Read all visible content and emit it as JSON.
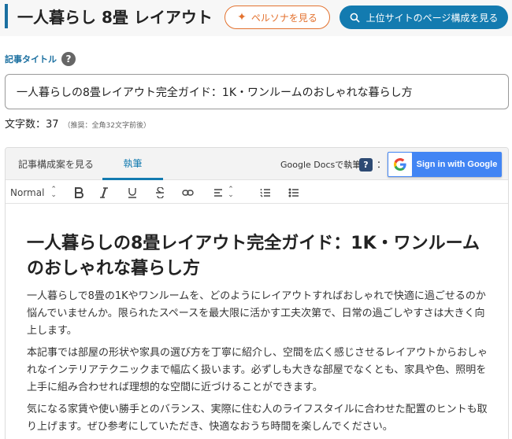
{
  "header": {
    "keyword": "一人暮らし 8畳 レイアウト",
    "persona_button": "ペルソナを見る",
    "top_sites_button": "上位サイトのページ構成を見る"
  },
  "article_title": {
    "label": "記事タイトル",
    "help": "?",
    "value": "一人暮らしの8畳レイアウト完全ガイド：1K・ワンルームのおしゃれな暮らし方"
  },
  "char_count": {
    "text": "文字数：37",
    "hint": "（推奨：全角32文字前後）"
  },
  "editor": {
    "tabs": [
      {
        "label": "記事構成案を見る",
        "active": false
      },
      {
        "label": "執筆",
        "active": true
      }
    ],
    "gdocs_label": "Google Docsで執筆",
    "gdocs_help": "?",
    "gdocs_colon": "：",
    "google_signin": "Sign in with Google",
    "toolbar": {
      "format_value": "Normal",
      "icons": [
        "bold-icon",
        "italic-icon",
        "underline-icon",
        "strikethrough-icon",
        "link-icon",
        "align-icon",
        "ordered-list-icon",
        "bullet-list-icon"
      ]
    },
    "content": {
      "heading": "一人暮らしの8畳レイアウト完全ガイド：1K・ワンルームのおしゃれな暮らし方",
      "paragraphs": [
        "一人暮らしで8畳の1Kやワンルームを、どのようにレイアウトすればおしゃれで快適に過ごせるのか悩んでいませんか。限られたスペースを最大限に活かす工夫次第で、日常の過ごしやすさは大きく向上します。",
        "本記事では部屋の形状や家具の選び方を丁寧に紹介し、空間を広く感じさせるレイアウトからおしゃれなインテリアテクニックまで幅広く扱います。必ずしも大きな部屋でなくとも、家具や色、照明を上手に組み合わせれば理想的な空間に近づけることができます。",
        "気になる家賃や使い勝手とのバランス、実際に住む人のライフスタイルに合わせた配置のヒントも取り上げます。ぜひ参考にしていただき、快適なおうち時間を楽しんでください。"
      ]
    }
  },
  "colors": {
    "accent_blue": "#137bb0",
    "persona_orange": "#e3722f",
    "google_blue": "#4285f4"
  }
}
